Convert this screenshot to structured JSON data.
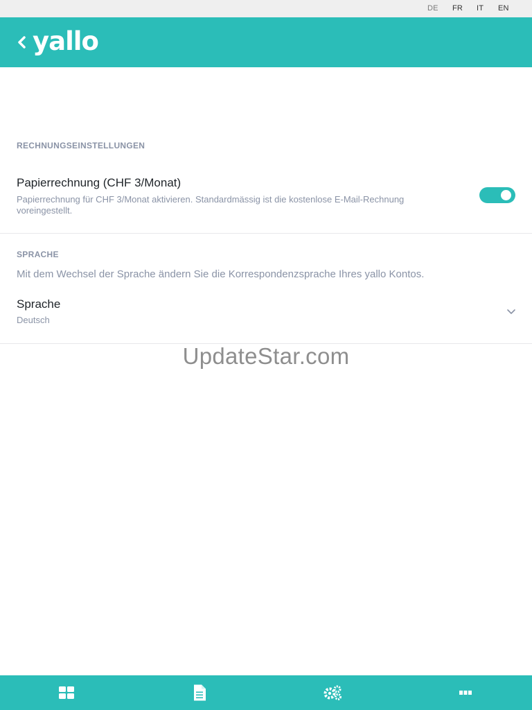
{
  "languages": [
    "DE",
    "FR",
    "IT",
    "EN"
  ],
  "header": {
    "brand": "yallo"
  },
  "billing": {
    "section_title": "RECHNUNGSEINSTELLUNGEN",
    "paper_invoice": {
      "title": "Papierrechnung (CHF 3/Monat)",
      "description": "Papierrechnung für CHF 3/Monat aktivieren. Standardmässig ist die kostenlose E-Mail-Rechnung voreingestellt.",
      "enabled": true
    }
  },
  "language_settings": {
    "section_title": "SPRACHE",
    "hint": "Mit dem Wechsel der Sprache ändern Sie die Korrespondenzsprache Ihres yallo Kontos.",
    "field_label": "Sprache",
    "selected_value": "Deutsch"
  },
  "watermark": "UpdateStar.com",
  "colors": {
    "accent": "#2bbdb8",
    "muted_text": "#8a93a6"
  },
  "bottom_nav": [
    {
      "icon": "dashboard-grid-icon"
    },
    {
      "icon": "document-icon"
    },
    {
      "icon": "settings-gears-icon"
    },
    {
      "icon": "more-dots-icon"
    }
  ]
}
